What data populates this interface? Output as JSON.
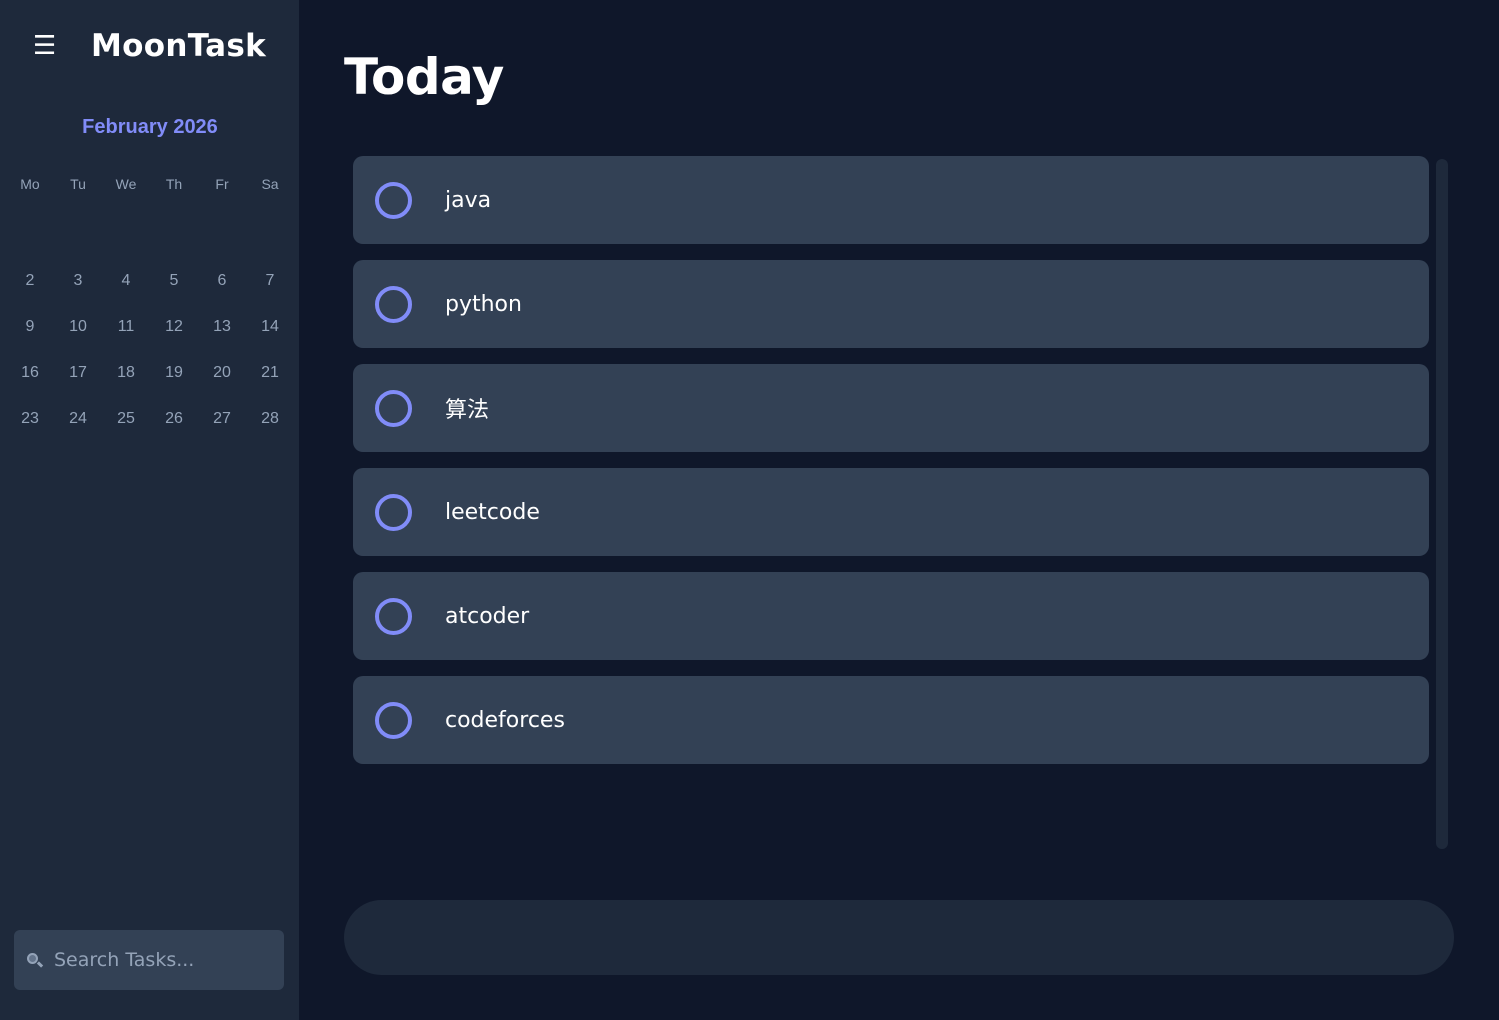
{
  "app": {
    "title": "MoonTask",
    "menu_glyph": "☰"
  },
  "calendar": {
    "month_label": "February 2026",
    "weekdays": [
      "Mo",
      "Tu",
      "We",
      "Th",
      "Fr",
      "Sa"
    ],
    "weeks": [
      [
        "2",
        "3",
        "4",
        "5",
        "6",
        "7"
      ],
      [
        "9",
        "10",
        "11",
        "12",
        "13",
        "14"
      ],
      [
        "16",
        "17",
        "18",
        "19",
        "20",
        "21"
      ],
      [
        "23",
        "24",
        "25",
        "26",
        "27",
        "28"
      ]
    ]
  },
  "search": {
    "placeholder": "Search Tasks..."
  },
  "main": {
    "title": "Today",
    "tasks": [
      {
        "label": "java",
        "done": false
      },
      {
        "label": "python",
        "done": false
      },
      {
        "label": "算法",
        "done": false
      },
      {
        "label": "leetcode",
        "done": false
      },
      {
        "label": "atcoder",
        "done": false
      },
      {
        "label": "codeforces",
        "done": false
      }
    ],
    "add_task_value": ""
  },
  "colors": {
    "background": "#0f172a",
    "sidebar": "#1e293b",
    "card": "#334155",
    "accent": "#818cf8",
    "muted_text": "#94a3b8"
  }
}
